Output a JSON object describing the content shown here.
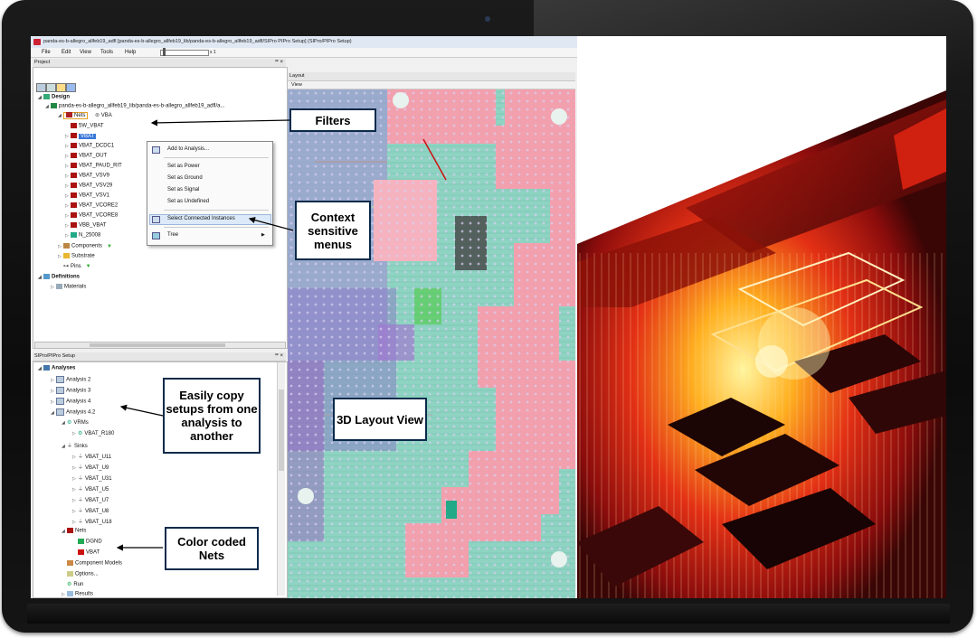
{
  "window": {
    "title": "panda-es-b-allegro_allfeb19_adfl [panda-es-b-allegro_allfeb19_lib/panda-es-b-allegro_allfeb19_adfl/SIPro PIPro Setup] (SIPro/PIPro Setup)"
  },
  "menubar": {
    "items": [
      "File",
      "Edit",
      "View",
      "Tools",
      "Help"
    ],
    "zoom_label": "x 1"
  },
  "project_pane": {
    "title": "Project",
    "controls": "ꟹ ×",
    "tree": {
      "design": "Design",
      "design_file": "panda-es-b-allegro_allfeb19_lib/panda-es-b-allegro_allfeb19_adfl/a...",
      "nets": "Nets",
      "filter_text": "VBA",
      "net_items": [
        "5W_VBAT",
        "VBAT",
        "VBAT_DCDC1",
        "VBAT_OUT",
        "VBAT_PAUD_RIT",
        "VBAT_VSV9",
        "VBAT_VSV29",
        "VBAT_VSV1",
        "VBAT_VCORE2",
        "VBAT_VCORE8",
        "VBB_VBAT",
        "N_25008"
      ],
      "components": "Components",
      "substrate": "Substrate",
      "pins": "Pins",
      "definitions": "Definitions",
      "materials": "Materials"
    }
  },
  "context_menu": {
    "items": [
      "Add to Analysis...",
      "Set as Power",
      "Set as Ground",
      "Set as Signal",
      "Set as Undefined",
      "Select Connected Instances",
      "Tree"
    ]
  },
  "layout_pane": {
    "title": "Layout",
    "sub": "View"
  },
  "setup_pane": {
    "title": "SIPro/PIPro Setup",
    "controls": "ꟹ ×",
    "tree": {
      "analyses": "Analyses",
      "analysis_items": [
        "Analysis 2",
        "Analysis 3",
        "Analysis 4",
        "Analysis 4.2"
      ],
      "vrms": "VRMs",
      "vrm_item": "VBAT_R180",
      "sinks": "Sinks",
      "sink_items": [
        "VBAT_U11",
        "VBAT_U9",
        "VBAT_U31",
        "VBAT_U5",
        "VBAT_U7",
        "VBAT_U8",
        "VBAT_U18"
      ],
      "nets": "Nets",
      "net_items": [
        "DGND",
        "VBAT"
      ],
      "component_models": "Component Models",
      "options": "Options...",
      "run": "Run",
      "results": "Results"
    }
  },
  "callouts": {
    "filters": "Filters",
    "context_menus": "Context sensitive menus",
    "copy_setups": "Easily copy setups from one analysis to another",
    "layout_view": "3D Layout View",
    "color_nets": "Color coded Nets"
  },
  "colors": {
    "callout_border": "#0b2a4a",
    "pcb_base": "#8fd3c2",
    "pcb_copper": "#f2a0ae",
    "pcb_purple": "#9a7ad0",
    "render_hot": "#ffcc33",
    "render_dark": "#2a0505"
  }
}
